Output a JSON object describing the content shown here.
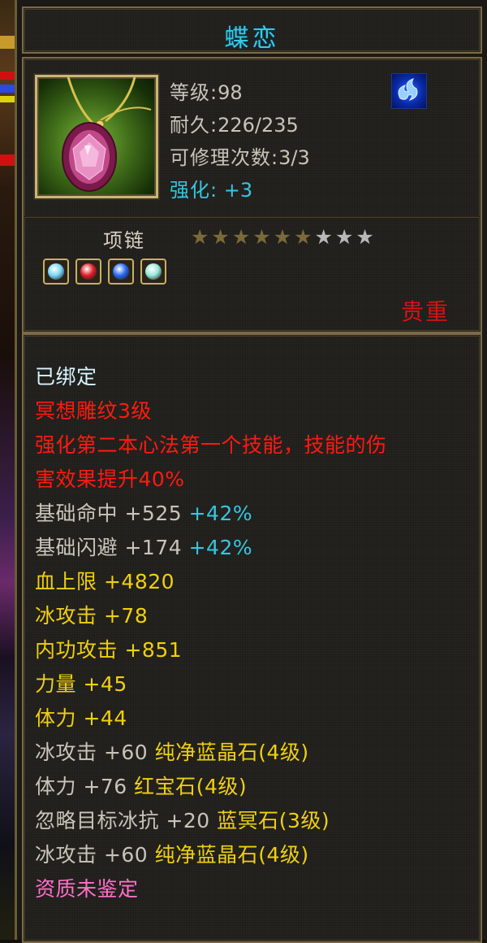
{
  "item": {
    "name": "蝶恋",
    "level_label": "等级:",
    "level": "98",
    "durability_label": "耐久:",
    "durability": "226/235",
    "repair_label": "可修理次数:",
    "repair": "3/3",
    "enhance_label": "强化:",
    "enhance": "+3",
    "type": "项链",
    "rarity": "贵重",
    "class_icon": "blue-flame-icon"
  },
  "stars": {
    "total": 9,
    "filled": 6
  },
  "gems": [
    {
      "icon": "ice-gem-icon",
      "color": "#7ad8f8"
    },
    {
      "icon": "ruby-gem-icon",
      "color": "#e0202a"
    },
    {
      "icon": "sapphire-gem-icon",
      "color": "#2a6cf0"
    },
    {
      "icon": "ice-gem-icon",
      "color": "#9ae8d8"
    }
  ],
  "details": {
    "bound": "已绑定",
    "carving": "冥想雕纹3级",
    "effect_1": "强化第二本心法第一个技能，技能的伤",
    "effect_2": "害效果提升40%",
    "stat_1": {
      "name": "基础命中",
      "value": "+525",
      "pct": "+42%"
    },
    "stat_2": {
      "name": "基础闪避",
      "value": "+174",
      "pct": "+42%"
    },
    "stat_3": {
      "name": "血上限",
      "value": "+4820"
    },
    "stat_4": {
      "name": "冰攻击",
      "value": "+78"
    },
    "stat_5": {
      "name": "内功攻击",
      "value": "+851"
    },
    "stat_6": {
      "name": "力量",
      "value": "+45"
    },
    "stat_7": {
      "name": "体力",
      "value": "+44"
    },
    "gem_1": {
      "text": "冰攻击 +60",
      "gem": "纯净蓝晶石",
      "lvl": "(4级)"
    },
    "gem_2": {
      "text": "体力 +76",
      "gem": "红宝石",
      "lvl": "(4级)"
    },
    "gem_3": {
      "text": "忽略目标冰抗 +20",
      "gem": "蓝冥石",
      "lvl": "(3级)"
    },
    "gem_4": {
      "text": "冰攻击 +60",
      "gem": "纯净蓝晶石",
      "lvl": "(4级)"
    },
    "quality": "资质未鉴定"
  },
  "colors": {
    "white_text": "#c8c4b8",
    "bound": "#d8f4ff",
    "red": "#ff1a10",
    "gold": "#f0d010",
    "cyan": "#36c6e0",
    "pink": "#ff70c8"
  }
}
